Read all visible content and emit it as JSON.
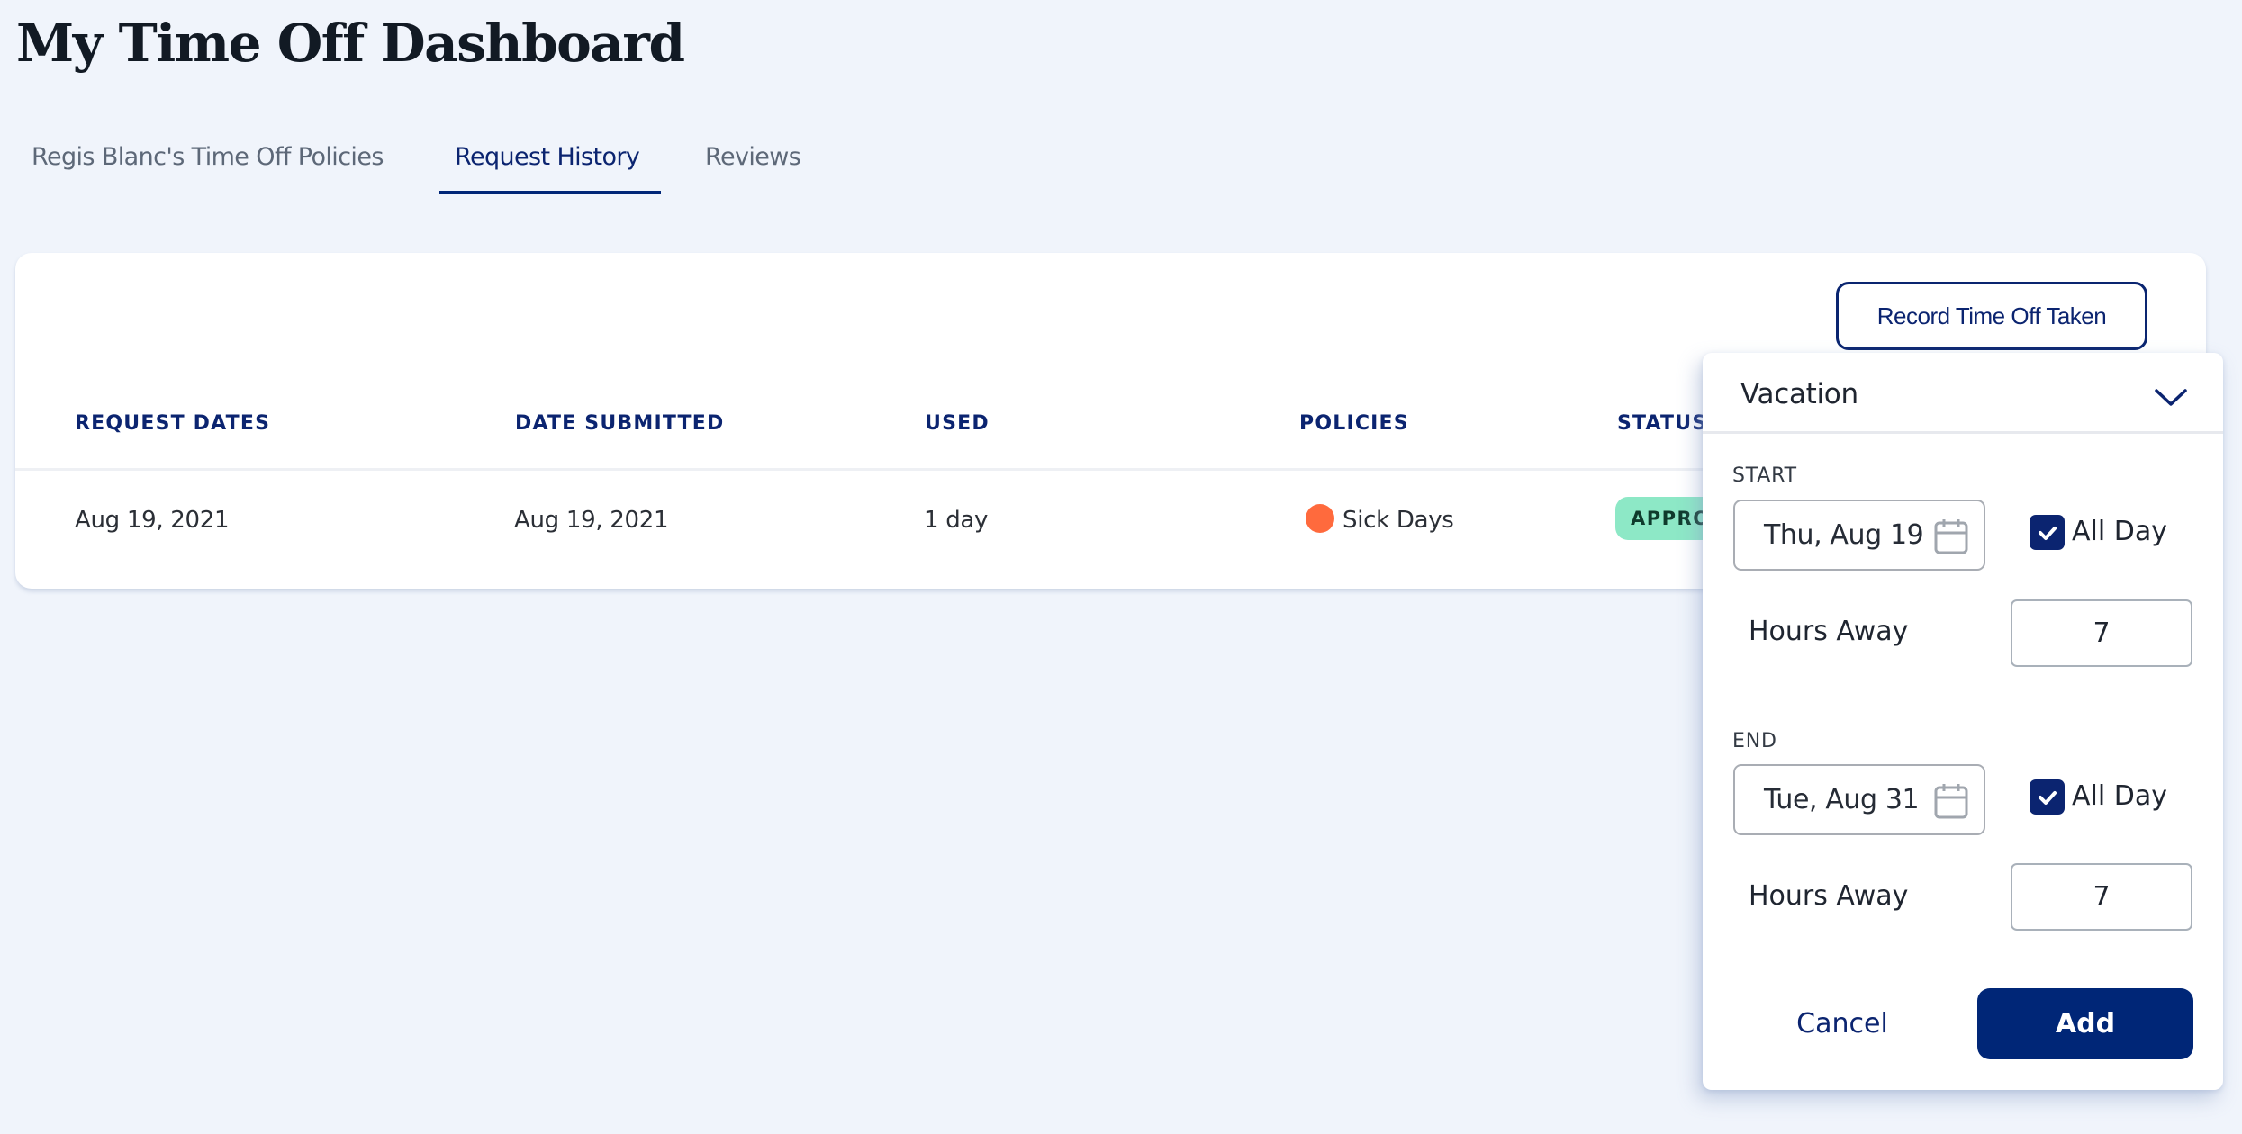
{
  "page": {
    "title": "My Time Off Dashboard"
  },
  "tabs": [
    {
      "label": "Regis Blanc's Time Off Policies",
      "active": false
    },
    {
      "label": "Request History",
      "active": true
    },
    {
      "label": "Reviews",
      "active": false
    }
  ],
  "toolbar": {
    "record_button_label": "Record Time Off Taken"
  },
  "table": {
    "columns": [
      "REQUEST DATES",
      "DATE SUBMITTED",
      "USED",
      "POLICIES",
      "STATUS"
    ],
    "rows": [
      {
        "request_dates": "Aug 19, 2021",
        "date_submitted": "Aug 19, 2021",
        "used": "1 day",
        "policy": "Sick Days",
        "policy_color": "#ff6a3d",
        "status": "APPROVED",
        "status_visible_text": "APPRO",
        "status_color": "#8de8c6"
      }
    ]
  },
  "popover": {
    "policy_select": {
      "value": "Vacation",
      "icon": "chevron-down-icon"
    },
    "start": {
      "label": "START",
      "date": "Thu, Aug 19",
      "date_icon": "calendar-icon",
      "all_day": true,
      "all_day_label": "All Day",
      "hours_label": "Hours Away",
      "hours_value": "7"
    },
    "end": {
      "label": "END",
      "date": "Tue, Aug 31",
      "date_icon": "calendar-icon",
      "all_day": true,
      "all_day_label": "All Day",
      "hours_label": "Hours Away",
      "hours_value": "7"
    },
    "cancel_label": "Cancel",
    "add_label": "Add"
  },
  "colors": {
    "background": "#f0f4fb",
    "brand_navy": "#002677",
    "tab_inactive": "#5d6878",
    "title": "#121a24"
  }
}
